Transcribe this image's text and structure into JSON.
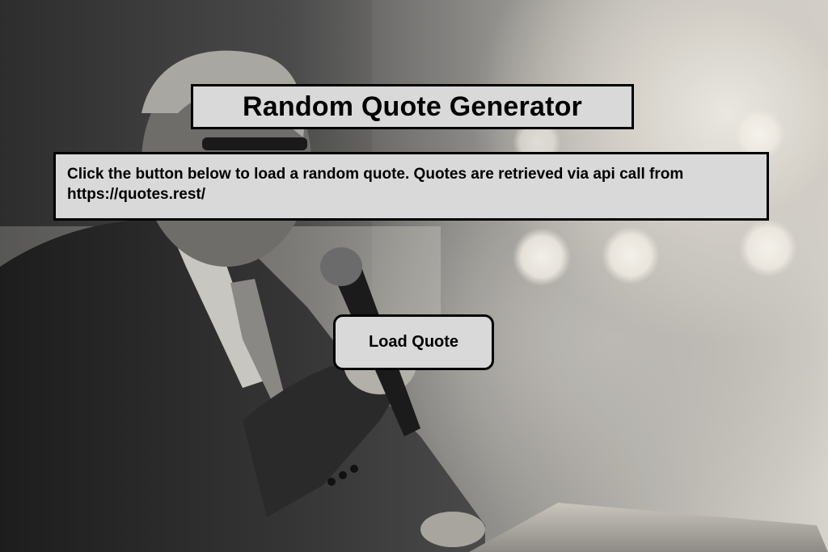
{
  "page": {
    "title": "Random Quote Generator",
    "description": "Click the button below to load a random quote. Quotes are retrieved via api call from https://quotes.rest/",
    "button_label": "Load Quote"
  },
  "background": {
    "subject": "speaker-with-microphone-photo"
  },
  "colors": {
    "panel": "#d9d9d9",
    "border": "#000000",
    "text": "#000000"
  }
}
